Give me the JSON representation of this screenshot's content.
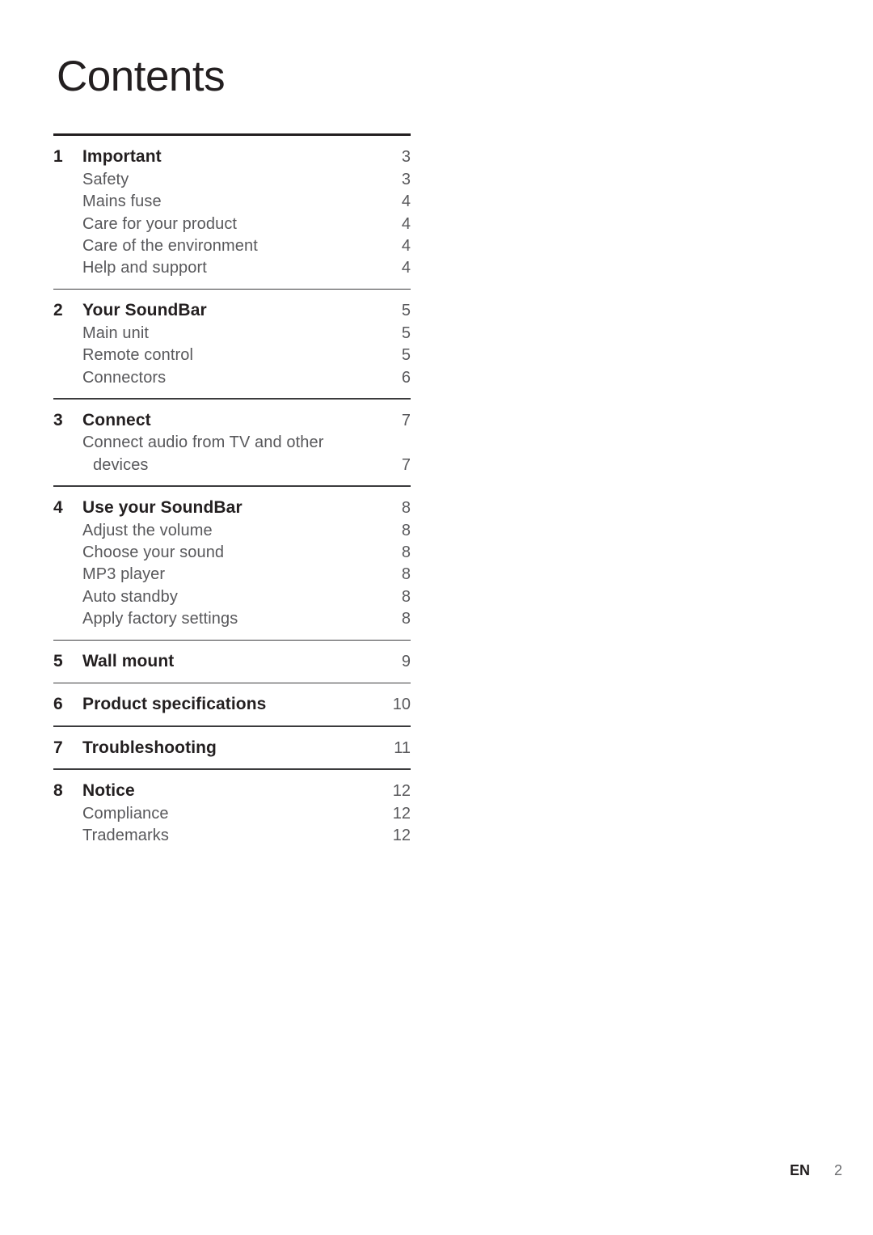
{
  "document": {
    "title": "Contents"
  },
  "toc": {
    "sections": [
      {
        "number": "1",
        "title": "Important",
        "page": "3",
        "items": [
          {
            "label": "Safety",
            "page": "3",
            "indent": false,
            "hide_page": false
          },
          {
            "label": "Mains fuse",
            "page": "4",
            "indent": false,
            "hide_page": false
          },
          {
            "label": "Care for your product",
            "page": "4",
            "indent": false,
            "hide_page": false
          },
          {
            "label": "Care of the environment",
            "page": "4",
            "indent": false,
            "hide_page": false
          },
          {
            "label": "Help and support",
            "page": "4",
            "indent": false,
            "hide_page": false
          }
        ]
      },
      {
        "number": "2",
        "title": "Your SoundBar",
        "page": "5",
        "items": [
          {
            "label": "Main unit",
            "page": "5",
            "indent": false,
            "hide_page": false
          },
          {
            "label": "Remote control",
            "page": "5",
            "indent": false,
            "hide_page": false
          },
          {
            "label": "Connectors",
            "page": "6",
            "indent": false,
            "hide_page": false
          }
        ]
      },
      {
        "number": "3",
        "title": "Connect",
        "page": "7",
        "items": [
          {
            "label": "Connect audio from TV and other",
            "page": "",
            "indent": false,
            "hide_page": true
          },
          {
            "label": "devices",
            "page": "7",
            "indent": true,
            "hide_page": false
          }
        ]
      },
      {
        "number": "4",
        "title": "Use your SoundBar",
        "page": "8",
        "items": [
          {
            "label": "Adjust the volume",
            "page": "8",
            "indent": false,
            "hide_page": false
          },
          {
            "label": "Choose your sound",
            "page": "8",
            "indent": false,
            "hide_page": false
          },
          {
            "label": "MP3 player",
            "page": "8",
            "indent": false,
            "hide_page": false
          },
          {
            "label": "Auto standby",
            "page": "8",
            "indent": false,
            "hide_page": false
          },
          {
            "label": "Apply factory settings",
            "page": "8",
            "indent": false,
            "hide_page": false
          }
        ]
      },
      {
        "number": "5",
        "title": "Wall mount",
        "page": "9",
        "items": []
      },
      {
        "number": "6",
        "title": "Product specifications",
        "page": "10",
        "items": []
      },
      {
        "number": "7",
        "title": "Troubleshooting",
        "page": "11",
        "items": []
      },
      {
        "number": "8",
        "title": "Notice",
        "page": "12",
        "items": [
          {
            "label": "Compliance",
            "page": "12",
            "indent": false,
            "hide_page": false
          },
          {
            "label": "Trademarks",
            "page": "12",
            "indent": false,
            "hide_page": false
          }
        ]
      }
    ]
  },
  "footer": {
    "language": "EN",
    "page_number": "2"
  },
  "colors": {
    "heading_text": "#231f20",
    "body_text": "#58585b",
    "rule_top": "#231f20",
    "rule_separator": "#3b3b3d",
    "background": "#ffffff"
  }
}
